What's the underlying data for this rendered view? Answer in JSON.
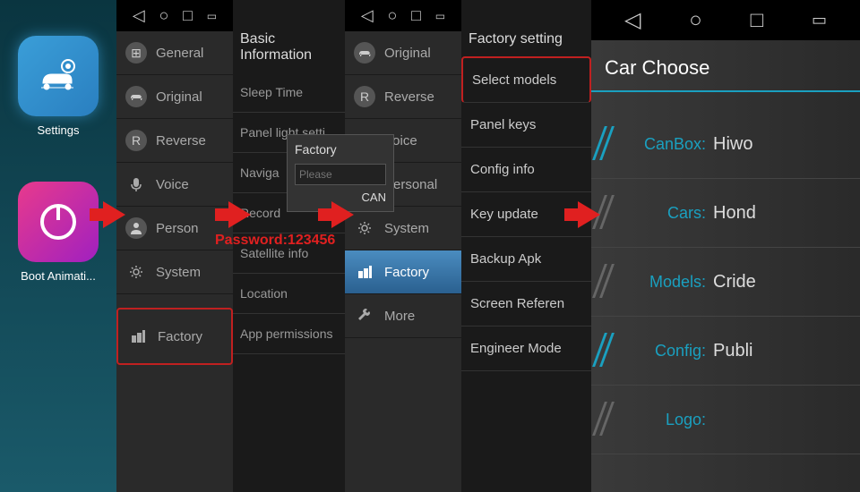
{
  "panel1": {
    "apps": [
      {
        "label": "Settings"
      },
      {
        "label": "Boot Animati..."
      }
    ]
  },
  "panel2": {
    "items": [
      {
        "label": "General"
      },
      {
        "label": "Original"
      },
      {
        "label": "Reverse"
      },
      {
        "label": "Voice"
      },
      {
        "label": "Person"
      },
      {
        "label": "System"
      },
      {
        "label": "Factory"
      }
    ]
  },
  "panel3": {
    "title": "Basic Information",
    "rows": [
      {
        "label": "Sleep Time"
      },
      {
        "label": "Panel light setti"
      },
      {
        "label": "Naviga"
      },
      {
        "label": "Record"
      },
      {
        "label": "Satellite info"
      },
      {
        "label": "Location"
      },
      {
        "label": "App permissions"
      }
    ],
    "dialog": {
      "title": "Factory",
      "placeholder": "Please",
      "button": "CAN"
    },
    "password_text": "Password:123456"
  },
  "panel4": {
    "items": [
      {
        "label": "Original"
      },
      {
        "label": "Reverse"
      },
      {
        "label": "Voice"
      },
      {
        "label": "Personal"
      },
      {
        "label": "System"
      },
      {
        "label": "Factory"
      },
      {
        "label": "More"
      }
    ]
  },
  "panel5": {
    "title": "Factory setting",
    "items": [
      {
        "label": "Select models"
      },
      {
        "label": "Panel keys"
      },
      {
        "label": "Config info"
      },
      {
        "label": "Key update"
      },
      {
        "label": "Backup Apk"
      },
      {
        "label": "Screen Referen"
      },
      {
        "label": "Engineer Mode"
      }
    ]
  },
  "panel6": {
    "title": "Car Choose",
    "rows": [
      {
        "label": "CanBox:",
        "value": "Hiwo"
      },
      {
        "label": "Cars:",
        "value": "Hond"
      },
      {
        "label": "Models:",
        "value": "Cride"
      },
      {
        "label": "Config:",
        "value": "Publi"
      },
      {
        "label": "Logo:",
        "value": ""
      }
    ]
  }
}
